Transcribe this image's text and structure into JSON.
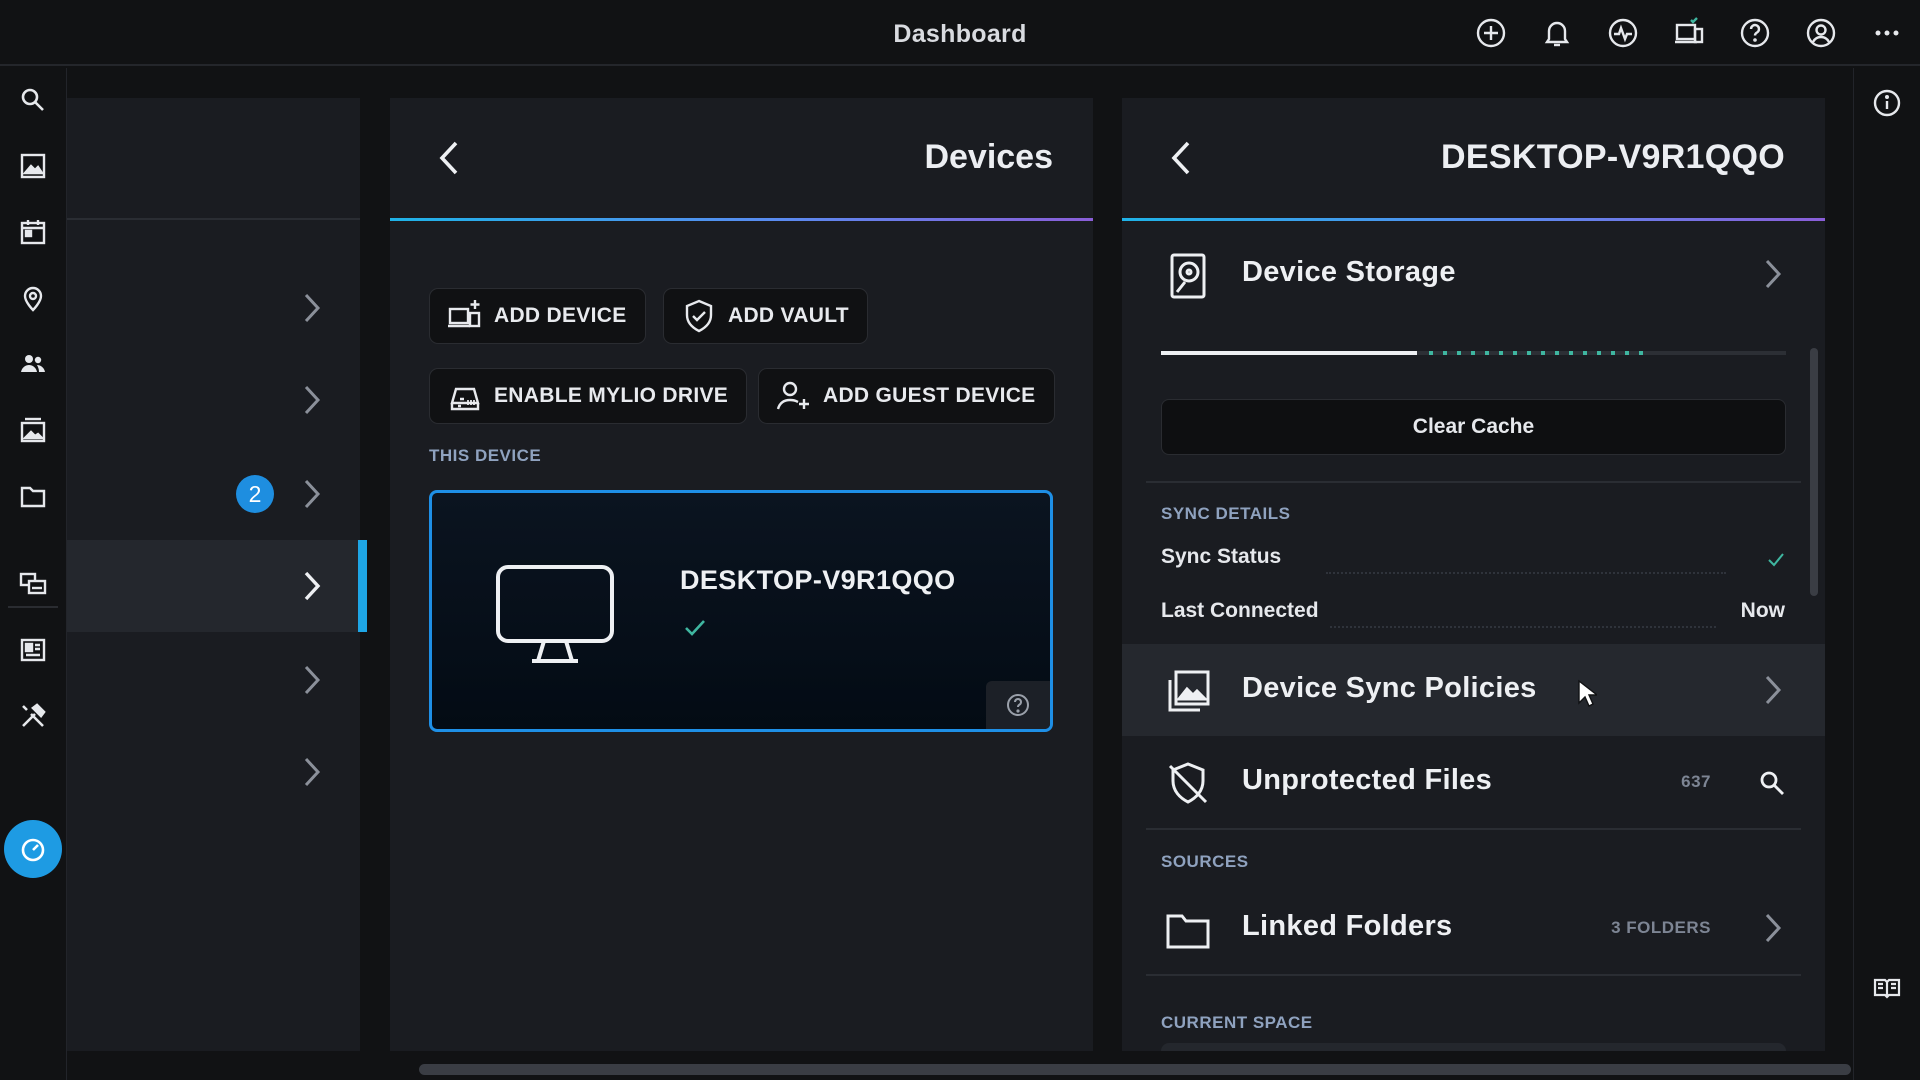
{
  "app": {
    "title": "Dashboard"
  },
  "topbar_icons": [
    "add-circle-icon",
    "bell-icon",
    "activity-icon",
    "devices-icon",
    "help-icon",
    "account-icon",
    "more-icon"
  ],
  "rail_icons": [
    "search-icon",
    "photos-icon",
    "calendar-icon",
    "map-pin-icon",
    "people-icon",
    "albums-icon",
    "folder-icon",
    "sources-icon",
    "dashboard-grid-icon",
    "tools-icon",
    "dashboard-gauge-icon"
  ],
  "panel1": {
    "badge": "2"
  },
  "devices_panel": {
    "title": "Devices",
    "buttons": {
      "add_device": "ADD DEVICE",
      "add_vault": "ADD VAULT",
      "enable_drive": "ENABLE MYLIO DRIVE",
      "add_guest": "ADD GUEST DEVICE"
    },
    "this_device_label": "THIS DEVICE",
    "device_card": {
      "name": "DESKTOP-V9R1QQO"
    }
  },
  "detail_panel": {
    "title": "DESKTOP-V9R1QQO",
    "device_storage": "Device Storage",
    "clear_cache": "Clear Cache",
    "sync_details_label": "SYNC DETAILS",
    "sync_status_label": "Sync Status",
    "last_connected_label": "Last Connected",
    "last_connected_value": "Now",
    "device_sync_policies": "Device Sync Policies",
    "unprotected_files": "Unprotected Files",
    "unprotected_count": "637",
    "sources_label": "SOURCES",
    "linked_folders": "Linked Folders",
    "linked_folders_meta": "3 FOLDERS",
    "current_space_label": "CURRENT SPACE"
  },
  "colors": {
    "accent": "#1e9be3",
    "success": "#3fb6a0",
    "background": "#111214",
    "panel": "#1a1c21"
  }
}
